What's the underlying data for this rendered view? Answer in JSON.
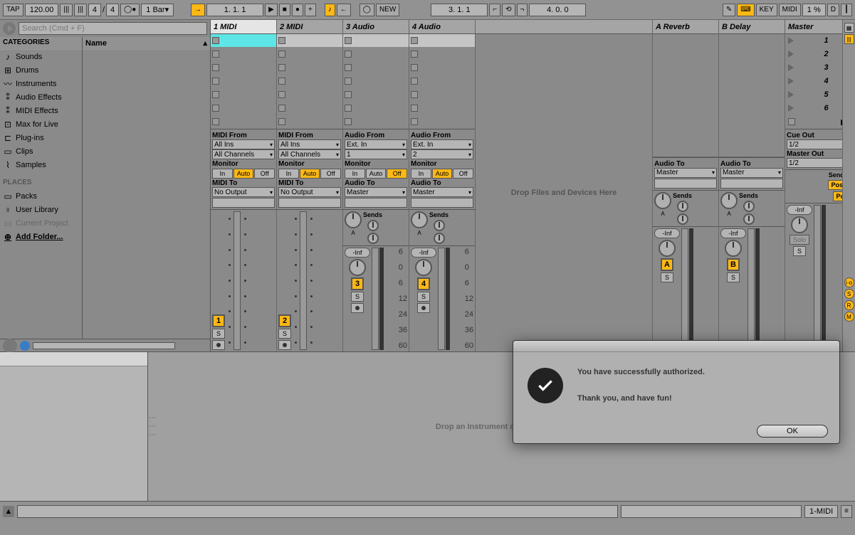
{
  "toolbar": {
    "tap": "TAP",
    "tempo": "120.00",
    "sig_num": "4",
    "sig_den": "4",
    "quantize": "1 Bar",
    "position": "1.  1.  1",
    "arr_position": "3.  1.  1",
    "loop_len": "4.  0.  0",
    "new": "NEW",
    "key": "KEY",
    "midi": "MIDI",
    "cpu": "1 %",
    "disk": "D"
  },
  "browser": {
    "search_placeholder": "Search (Cmd + F)",
    "cats_header": "CATEGORIES",
    "name_header": "Name",
    "cats": [
      "Sounds",
      "Drums",
      "Instruments",
      "Audio Effects",
      "MIDI Effects",
      "Max for Live",
      "Plug-ins",
      "Clips",
      "Samples"
    ],
    "places_header": "PLACES",
    "places": [
      "Packs",
      "User Library",
      "Current Project",
      "Add Folder..."
    ]
  },
  "session": {
    "tracks": [
      {
        "name": "1 MIDI",
        "from_label": "MIDI From",
        "from": "All Ins",
        "chan": "All Channels",
        "to_label": "MIDI To",
        "to": "No Output",
        "num": "1"
      },
      {
        "name": "2 MIDI",
        "from_label": "MIDI From",
        "from": "All Ins",
        "chan": "All Channels",
        "to_label": "MIDI To",
        "to": "No Output",
        "num": "2"
      },
      {
        "name": "3 Audio",
        "from_label": "Audio From",
        "from": "Ext. In",
        "chan": "1",
        "to_label": "Audio To",
        "to": "Master",
        "num": "3"
      },
      {
        "name": "4 Audio",
        "from_label": "Audio From",
        "from": "Ext. In",
        "chan": "2",
        "to_label": "Audio To",
        "to": "Master",
        "num": "4"
      }
    ],
    "returns": [
      {
        "name": "A Reverb",
        "to_label": "Audio To",
        "to": "Master",
        "num": "A"
      },
      {
        "name": "B Delay",
        "to_label": "Audio To",
        "to": "Master",
        "num": "B"
      }
    ],
    "master": {
      "name": "Master",
      "cue_label": "Cue Out",
      "cue": "1/2",
      "out_label": "Master Out",
      "out": "1/2",
      "solo": "Solo"
    },
    "monitor_label": "Monitor",
    "mon_in": "In",
    "mon_auto": "Auto",
    "mon_off": "Off",
    "sends_label": "Sends",
    "post": "Post",
    "s_label": "S",
    "inf": "-Inf",
    "db": [
      "6",
      "0",
      "6",
      "12",
      "24",
      "36",
      "60"
    ],
    "drop_msg": "Drop Files and Devices Here",
    "scenes": [
      "1",
      "2",
      "3",
      "4",
      "5",
      "6"
    ]
  },
  "detail": {
    "drop_msg": "Drop an Instrument or Sample Here"
  },
  "status": {
    "midi_track": "1-MIDI"
  },
  "dialog": {
    "line1": "You have successfully authorized.",
    "line2": "Thank you, and have fun!",
    "ok": "OK"
  }
}
